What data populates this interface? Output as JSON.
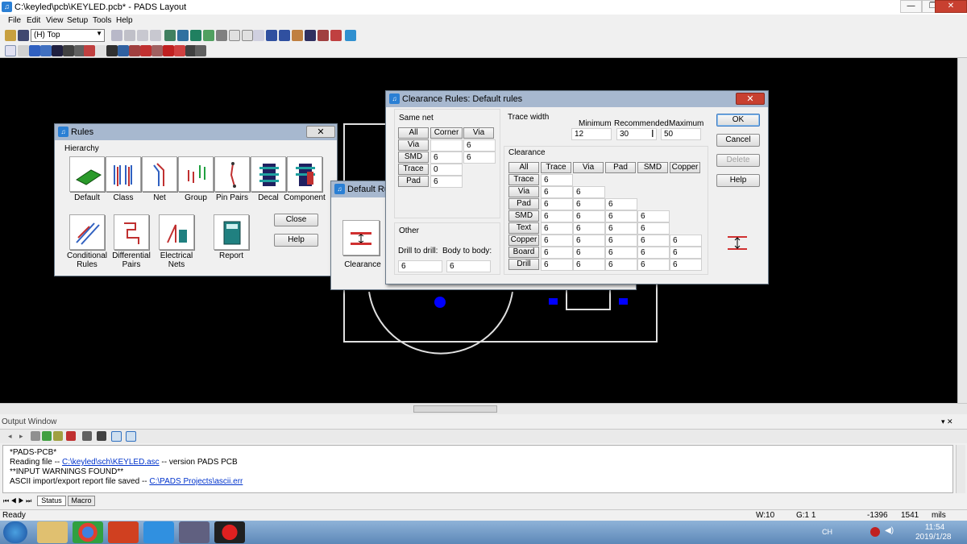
{
  "window": {
    "title": "C:\\keyled\\pcb\\KEYLED.pcb* - PADS Layout",
    "min": "—",
    "max": "❐",
    "close": "✕"
  },
  "menu": [
    "File",
    "Edit",
    "View",
    "Setup",
    "Tools",
    "Help"
  ],
  "toolbar": {
    "layer": "(H) Top"
  },
  "rules_dialog": {
    "title": "Rules",
    "hierarchy_label": "Hierarchy",
    "items": [
      "Default",
      "Class",
      "Net",
      "Group",
      "Pin Pairs",
      "Decal",
      "Component"
    ],
    "items2": [
      "Conditional Rules",
      "Differential Pairs",
      "Electrical Nets",
      "Report"
    ],
    "close": "Close",
    "help": "Help"
  },
  "default_rules_dialog": {
    "title": "Default Rules",
    "clearance": "Clearance"
  },
  "clearance_dialog": {
    "title": "Clearance Rules: Default rules",
    "same_net": {
      "label": "Same net",
      "headers": [
        "All",
        "Corner",
        "Via"
      ],
      "rows": [
        {
          "label": "Via",
          "values": [
            "",
            "6"
          ]
        },
        {
          "label": "SMD",
          "values": [
            "6",
            "6"
          ]
        },
        {
          "label": "Trace",
          "values": [
            "0"
          ]
        },
        {
          "label": "Pad",
          "values": [
            "6"
          ]
        }
      ]
    },
    "trace_width": {
      "label": "Trace width",
      "minimum_label": "Minimum",
      "recommended_label": "Recommended",
      "maximum_label": "Maximum",
      "minimum": "12",
      "recommended": "30",
      "maximum": "50"
    },
    "clearance": {
      "label": "Clearance",
      "headers": [
        "All",
        "Trace",
        "Via",
        "Pad",
        "SMD",
        "Copper"
      ],
      "rows": [
        {
          "label": "Trace",
          "values": [
            "6"
          ]
        },
        {
          "label": "Via",
          "values": [
            "6",
            "6"
          ]
        },
        {
          "label": "Pad",
          "values": [
            "6",
            "6",
            "6"
          ]
        },
        {
          "label": "SMD",
          "values": [
            "6",
            "6",
            "6",
            "6"
          ]
        },
        {
          "label": "Text",
          "values": [
            "6",
            "6",
            "6",
            "6"
          ]
        },
        {
          "label": "Copper",
          "values": [
            "6",
            "6",
            "6",
            "6",
            "6"
          ]
        },
        {
          "label": "Board",
          "values": [
            "6",
            "6",
            "6",
            "6",
            "6"
          ]
        },
        {
          "label": "Drill",
          "values": [
            "6",
            "6",
            "6",
            "6",
            "6"
          ]
        }
      ]
    },
    "other": {
      "label": "Other",
      "drill_to_drill_label": "Drill to drill:",
      "body_to_body_label": "Body to body:",
      "drill_to_drill": "6",
      "body_to_body": "6"
    },
    "buttons": {
      "ok": "OK",
      "cancel": "Cancel",
      "delete": "Delete",
      "help": "Help"
    }
  },
  "output": {
    "title": "Output Window",
    "lines": [
      {
        "text": "*PADS-PCB*"
      },
      {
        "prefix": "Reading file -- ",
        "link": "C:\\keyled\\sch\\KEYLED.asc",
        "suffix": " -- version PADS PCB"
      },
      {
        "text": "**INPUT WARNINGS FOUND**"
      },
      {
        "prefix": "ASCII import/export report file saved -- ",
        "link": "C:\\PADS Projects\\ascii.err",
        "suffix": ""
      }
    ],
    "tabs": [
      "Status",
      "Macro"
    ]
  },
  "status": {
    "ready": "Ready",
    "width": "W:10",
    "grid": "G:1 1",
    "x": "-1396",
    "y": "1541",
    "units": "mils"
  },
  "taskbar": {
    "time": "11:54",
    "date": "2019/1/28",
    "lang": "CH"
  },
  "colors": {
    "canvas": "#000000",
    "title_active": "#a7b8cf",
    "link": "#0033cc",
    "pad_blue": "#0000ff",
    "board_outline": "#e0e0e0"
  }
}
